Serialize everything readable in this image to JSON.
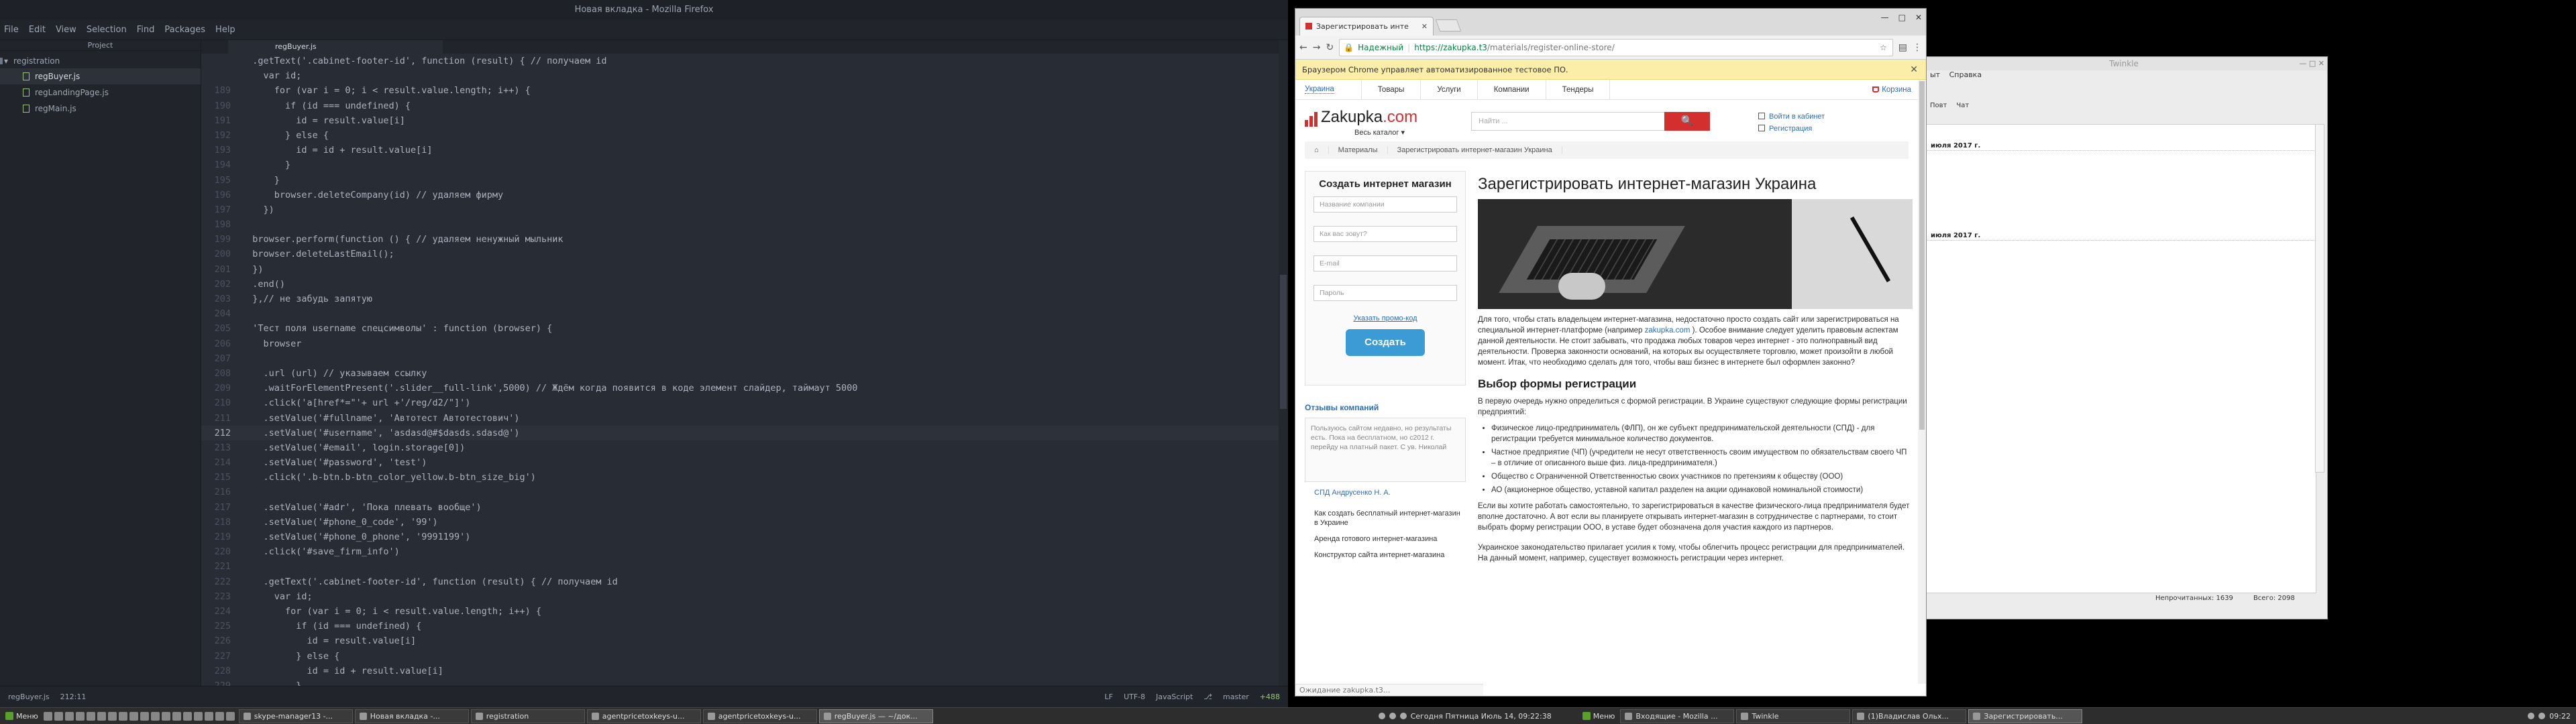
{
  "editor": {
    "window_title": "Новая вкладка - Mozilla Firefox",
    "menu": [
      "File",
      "Edit",
      "View",
      "Selection",
      "Find",
      "Packages",
      "Help"
    ],
    "panel_title": "Project",
    "tree": {
      "root": "registration",
      "files": [
        "regBuyer.js",
        "regLandingPage.js",
        "regMain.js"
      ]
    },
    "tab": "regBuyer.js",
    "code_lines": [
      {
        "n": "",
        "t": "  .getText('.cabinet-footer-id', function (result) { // получаем id"
      },
      {
        "n": "",
        "t": "    var id;"
      },
      {
        "n": "189",
        "t": "      for (var i = 0; i < result.value.length; i++) {"
      },
      {
        "n": "190",
        "t": "        if (id === undefined) {"
      },
      {
        "n": "191",
        "t": "          id = result.value[i]"
      },
      {
        "n": "192",
        "t": "        } else {"
      },
      {
        "n": "193",
        "t": "          id = id + result.value[i]"
      },
      {
        "n": "194",
        "t": "        }"
      },
      {
        "n": "195",
        "t": "      }"
      },
      {
        "n": "196",
        "t": "      browser.deleteCompany(id) // удаляем фирму"
      },
      {
        "n": "197",
        "t": "    })"
      },
      {
        "n": "198",
        "t": ""
      },
      {
        "n": "199",
        "t": "  browser.perform(function () { // удаляем ненужный мыльник"
      },
      {
        "n": "200",
        "t": "  browser.deleteLastEmail();"
      },
      {
        "n": "201",
        "t": "  })"
      },
      {
        "n": "202",
        "t": "  .end()"
      },
      {
        "n": "203",
        "t": "  },// не забудь запятую"
      },
      {
        "n": "204",
        "t": ""
      },
      {
        "n": "205",
        "t": "  'Тест поля username спецсимволы' : function (browser) {"
      },
      {
        "n": "206",
        "t": "    browser"
      },
      {
        "n": "207",
        "t": ""
      },
      {
        "n": "208",
        "t": "    .url (url) // указываем ссылку"
      },
      {
        "n": "209",
        "t": "    .waitForElementPresent('.slider__full-link',5000) // Ждём когда появится в коде элемент слайдер, таймаут 5000"
      },
      {
        "n": "210",
        "t": "    .click('a[href*=\"'+ url +'/reg/d2/\"]')"
      },
      {
        "n": "211",
        "t": "    .setValue('#fullname', 'Автотест Автотестович')"
      },
      {
        "n": "212",
        "t": "    .setValue('#username', 'asdasd@#$dasds.sdasd@')"
      },
      {
        "n": "213",
        "t": "    .setValue('#email', login.storage[0])"
      },
      {
        "n": "214",
        "t": "    .setValue('#password', 'test')"
      },
      {
        "n": "215",
        "t": "    .click('.b-btn.b-btn_color_yellow.b-btn_size_big')"
      },
      {
        "n": "216",
        "t": ""
      },
      {
        "n": "217",
        "t": "    .setValue('#adr', 'Пока плевать вообще')"
      },
      {
        "n": "218",
        "t": "    .setValue('#phone_0_code', '99')"
      },
      {
        "n": "219",
        "t": "    .setValue('#phone_0_phone', '9991199')"
      },
      {
        "n": "220",
        "t": "    .click('#save_firm_info')"
      },
      {
        "n": "221",
        "t": ""
      },
      {
        "n": "222",
        "t": "    .getText('.cabinet-footer-id', function (result) { // получаем id"
      },
      {
        "n": "223",
        "t": "      var id;"
      },
      {
        "n": "224",
        "t": "        for (var i = 0; i < result.value.length; i++) {"
      },
      {
        "n": "225",
        "t": "          if (id === undefined) {"
      },
      {
        "n": "226",
        "t": "            id = result.value[i]"
      },
      {
        "n": "227",
        "t": "          } else {"
      },
      {
        "n": "228",
        "t": "            id = id + result.value[i]"
      },
      {
        "n": "229",
        "t": "          }"
      },
      {
        "n": "230",
        "t": "        }"
      }
    ],
    "current_line": "212",
    "status": {
      "file": "regBuyer.js",
      "pos": "212:11",
      "eol": "LF",
      "encoding": "UTF-8",
      "grammar": "JavaScript",
      "branch": "master",
      "diff": "+488"
    }
  },
  "chrome": {
    "tab_title": "Зарегистрировать инте",
    "secure_label": "Надежный",
    "url_host": "https://zakupka.t3",
    "url_path": "/materials/register-online-store/",
    "automation_bar": "Браузером Chrome управляет автоматизированное тестовое ПО.",
    "status_text": "Ожидание zakupka.t3...",
    "site": {
      "region": "Украина",
      "nav": [
        "Товары",
        "Услуги",
        "Компании",
        "Тендеры"
      ],
      "cart": "Корзина",
      "logo": "Zakupka",
      "logo_tld": ".com",
      "catalog": "Весь каталог",
      "search_placeholder": "Найти ...",
      "login": "Войти в кабинет",
      "register": "Регистрация",
      "breadcrumbs": [
        "Материалы",
        "Зарегистрировать интернет-магазин Украина"
      ],
      "form": {
        "title": "Создать интернет магазин",
        "placeholders": [
          "Название компании",
          "Как вас зовут?",
          "E-mail",
          "Пароль"
        ],
        "promo": "Указать промо-код",
        "submit": "Создать"
      },
      "reviews_title": "Отзывы компаний",
      "review_text": "Пользуюсь сайтом недавно, но результаты есть. Пока на бесплатном, но с2012 г. перейду на платный пакет. С ув. Николай",
      "review_author": "СПД Андрусенко Н. А.",
      "side_links": [
        "Как создать бесплатный интернет-магазин в Украине",
        "Аренда готового интернет-магазина",
        "Конструктор сайта интернет-магазина"
      ],
      "h1": "Зарегистрировать интернет-магазин Украина",
      "p1_a": "Для того, чтобы стать владельцем интернет-магазина, недостаточно просто создать сайт или зарегистрироваться на специальной интернет-платформе (например ",
      "p1_link": "zakupka.com",
      "p1_b": " ). Особое внимание следует уделить правовым аспектам данной деятельности. Не стоит забывать, что продажа любых товаров через интернет - это полноправный вид деятельности. Проверка законности оснований, на которых вы осуществляете торговлю, может произойти в любой момент. Итак, что необходимо сделать для того, чтобы ваш бизнес в интернете был оформлен законно?",
      "h2": "Выбор формы регистрации",
      "p2": "В первую очередь нужно определиться с формой регистрации. В Украине существуют следующие формы регистрации предприятий:",
      "bullets": [
        "Физическое лицо-предприниматель (ФЛП), он же субъект предпринимательской деятельности (СПД) - для регистрации требуется минимальное количество документов.",
        "Частное предприятие (ЧП) (учредители не несут ответственность своим имуществом по обязательствам своего ЧП – в отличие от описанного выше физ. лица-предпринимателя.)",
        "Общество с Ограниченной Ответственностью своих участников по претензиям к обществу (ООО)",
        "АО (акционерное общество, уставной капитал разделен на акции одинаковой номинальной стоимости)"
      ],
      "p3": "Если вы хотите работать самостоятельно, то зарегистрироваться в качестве физического-лица предпринимателя будет вполне достаточно. А вот если вы планируете открывать интернет-магазин в сотрудничестве с партнерами, то стоит выбрать форму регистрации ООО, в уставе будет обозначена доля участия каждого из партнеров.",
      "p4": "Украинское законодательство прилагает усилия к тому, чтобы облегчить процесс регистрации для предпринимателей. На данный момент, например, существует возможность регистрации через интернет."
    }
  },
  "twinkle": {
    "title": "Twinkle",
    "menu": [
      "ыт",
      "Справка"
    ],
    "toolbar": [
      "Повт",
      "Чат"
    ],
    "dates": [
      "июля 2017 г.",
      "июля 2017 г."
    ],
    "status_unread": "Непрочитанных: 1639",
    "status_total": "Всего: 2098"
  },
  "taskbar": {
    "start_left": "Меню",
    "tasks_left": [
      "skype-manager13 -...",
      "Новая вкладка -...",
      "registration",
      "agentpricetoxkeys-u...",
      "agentpricetoxkeys-u...",
      "regBuyer.js — ~/док..."
    ],
    "tray_left": "Сегодня Пятница Июль 14, 09:22:38",
    "start_right": "Меню",
    "tasks_right": [
      "Входящие - Mozilla ...",
      "Twinkle",
      "(1)Владислав Ольх...",
      "Зарегистрировать..."
    ],
    "clock_right": "09:22"
  }
}
